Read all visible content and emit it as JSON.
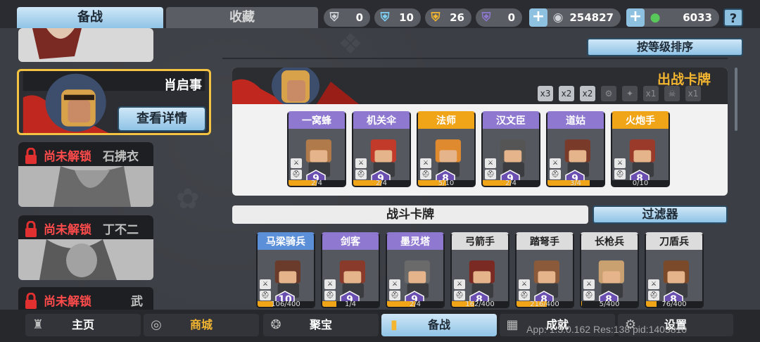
{
  "tabs": {
    "prep": "备战",
    "favorites": "收藏"
  },
  "resources": [
    {
      "icon": "silver-shield-icon",
      "value": "0",
      "color": "#c8ccd2"
    },
    {
      "icon": "blue-shield-icon",
      "value": "10",
      "color": "#7fd0f5"
    },
    {
      "icon": "gold-shield-icon",
      "value": "26",
      "color": "#f4b630"
    },
    {
      "icon": "purple-shield-icon",
      "value": "0",
      "color": "#8e78d0"
    }
  ],
  "currency": [
    {
      "icon": "silver-coin-icon",
      "value": "254827"
    },
    {
      "icon": "green-gem-icon",
      "value": "6033"
    }
  ],
  "help_label": "?",
  "heroes": [
    {
      "locked": false,
      "name": "",
      "lock_text": ""
    },
    {
      "locked": false,
      "name": "肖启事",
      "lock_text": "",
      "selected": true
    },
    {
      "locked": true,
      "name": "石拂衣",
      "lock_text": "尚未解锁"
    },
    {
      "locked": true,
      "name": "丁不二",
      "lock_text": "尚未解锁"
    },
    {
      "locked": true,
      "name": "武",
      "lock_text": "尚未解锁"
    }
  ],
  "detail_button": "查看详情",
  "sort_button": "按等级排序",
  "deck": {
    "title": "出战卡牌",
    "slots": [
      {
        "label": "x3",
        "on": true
      },
      {
        "label": "x2",
        "on": true
      },
      {
        "label": "x2",
        "on": true
      },
      {
        "label": "⚙",
        "on": false
      },
      {
        "label": "✦",
        "on": false
      },
      {
        "label": "x1",
        "on": false
      },
      {
        "label": "☠",
        "on": false
      },
      {
        "label": "x1",
        "on": false
      }
    ],
    "cards": [
      {
        "name": "一窝蜂",
        "level": "9",
        "count": "2/4",
        "progress": 0.5,
        "color": "#8e78d0",
        "art": "#b07a4a"
      },
      {
        "name": "机关伞",
        "level": "9",
        "count": "2/4",
        "progress": 0.5,
        "color": "#8e78d0",
        "art": "#c23a2a"
      },
      {
        "name": "法师",
        "level": "8",
        "count": "5/10",
        "progress": 0.5,
        "color": "#f0a418",
        "art": "#e08a30"
      },
      {
        "name": "汉文臣",
        "level": "9",
        "count": "2/4",
        "progress": 0.5,
        "color": "#8e78d0",
        "art": "#555"
      },
      {
        "name": "道姑",
        "level": "9",
        "count": "3/4",
        "progress": 0.75,
        "color": "#8e78d0",
        "art": "#7a3a2a"
      },
      {
        "name": "火炮手",
        "level": "8",
        "count": "0/10",
        "progress": 0.0,
        "color": "#f0a418",
        "art": "#9a3a2a"
      }
    ]
  },
  "battle_bar": "战斗卡牌",
  "filter_button": "过滤器",
  "battle_cards": [
    {
      "name": "马梁骑兵",
      "level": "10",
      "count": "106/400",
      "progress": 0.27,
      "color": "#5b8fd8"
    },
    {
      "name": "剑客",
      "level": "9",
      "count": "1/4",
      "progress": 0.25,
      "color": "#8e78d0"
    },
    {
      "name": "墨灵塔",
      "level": "9",
      "count": "2/4",
      "progress": 0.5,
      "color": "#8e78d0"
    },
    {
      "name": "弓箭手",
      "level": "8",
      "count": "162/400",
      "progress": 0.4,
      "color": "#dcdcdc"
    },
    {
      "name": "踏弩手",
      "level": "8",
      "count": "216/400",
      "progress": 0.54,
      "color": "#dcdcdc"
    },
    {
      "name": "长枪兵",
      "level": "8",
      "count": "5/400",
      "progress": 0.01,
      "color": "#dcdcdc"
    },
    {
      "name": "刀盾兵",
      "level": "8",
      "count": "76/400",
      "progress": 0.19,
      "color": "#dcdcdc"
    }
  ],
  "nav": [
    {
      "label": "主页",
      "icon": "castle-icon"
    },
    {
      "label": "商城",
      "icon": "coins-icon"
    },
    {
      "label": "聚宝",
      "icon": "treasure-icon"
    },
    {
      "label": "备战",
      "icon": "card-icon",
      "active": true
    },
    {
      "label": "成就",
      "icon": "achievement-icon"
    },
    {
      "label": "设置",
      "icon": "gear-icon"
    }
  ],
  "build_info": "App: 1.3.0.162 Res:138 pid:1403810"
}
